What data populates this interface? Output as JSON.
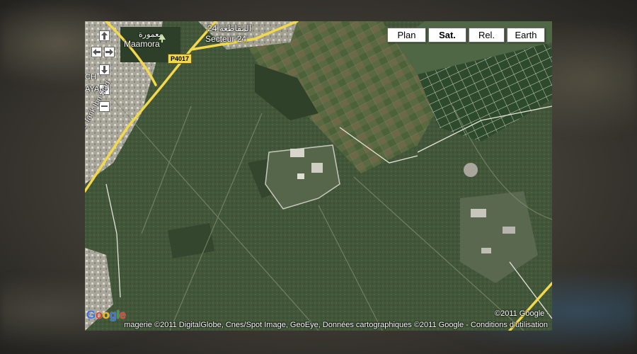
{
  "map_types": [
    {
      "label": "Plan",
      "active": false
    },
    {
      "label": "Sat.",
      "active": true
    },
    {
      "label": "Rel.",
      "active": false
    },
    {
      "label": "Earth",
      "active": false
    }
  ],
  "labels": {
    "place_arabic": "معمورة",
    "place_latin": "Maamora",
    "sector_arabic": "المقاطعة 24",
    "sector_latin": "Secteur 24",
    "road_number": "P4017",
    "avenue": "Avenue Tarik Ibn Ziad",
    "partial_left_1": "CH",
    "partial_left_2": "AYA"
  },
  "logo_letters": [
    "G",
    "o",
    "o",
    "g",
    "l",
    "e"
  ],
  "copyright": "©2011 Google -",
  "attribution": "magerie ©2011 DigitalGlobe, Cnes/Spot Image, GeoEye, Données cartographiques ©2011 Google - Conditions d'utilisation",
  "colors": {
    "forest": "#3f5236",
    "field_dark": "#2f4229",
    "road_yellow": "#f2d84a",
    "urban": "#b9b6ad"
  }
}
